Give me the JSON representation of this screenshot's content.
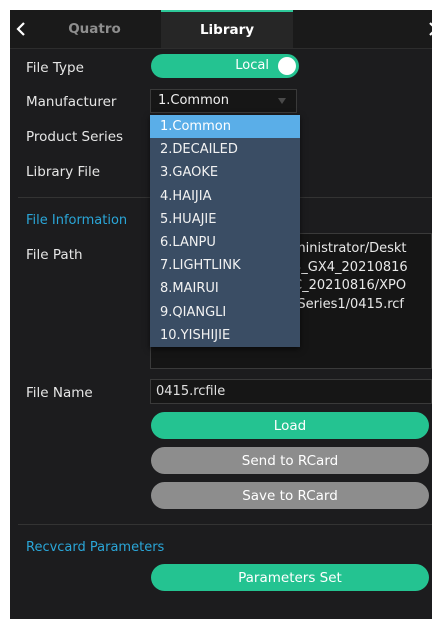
{
  "tabs": {
    "quatro": "Quatro",
    "library": "Library"
  },
  "icons": {
    "back": "chevron-left-icon",
    "forward": "chevron-right-icon",
    "caret": "caret-down-icon"
  },
  "colors": {
    "accent_green": "#24c391",
    "section_blue": "#2aa6d8",
    "selected_blue": "#5aaee8",
    "dropdown_bg": "#3a4d64",
    "disabled_gray": "#8d8d8d"
  },
  "form": {
    "file_type_label": "File Type",
    "file_type_toggle": "Local",
    "manufacturer_label": "Manufacturer",
    "manufacturer_value": "1.Common",
    "product_series_label": "Product Series",
    "library_file_label": "Library File"
  },
  "manufacturer_options": [
    "1.Common",
    "2.DECAILED",
    "3.GAOKE",
    "4.HAIJIA",
    "5.HUAJIE",
    "6.LANPU",
    "7.LIGHTLINK",
    "8.MAIRUI",
    "9.QIANGLI",
    "10.YISHIJIE"
  ],
  "file_info": {
    "section_title": "File Information",
    "path_label": "File Path",
    "path_lines": [
      "ministrator/Deskt",
      "3_GX4_20210816",
      "C_20210816/XPO",
      "/Series1/0415.rcf"
    ],
    "name_label": "File Name",
    "name_value": "0415.rcfile"
  },
  "buttons": {
    "load": "Load",
    "send_to_rcard": "Send to RCard",
    "save_to_rcard": "Save to RCard",
    "parameters_set": "Parameters Set"
  },
  "recvcard": {
    "section_title": "Recvcard Parameters"
  }
}
